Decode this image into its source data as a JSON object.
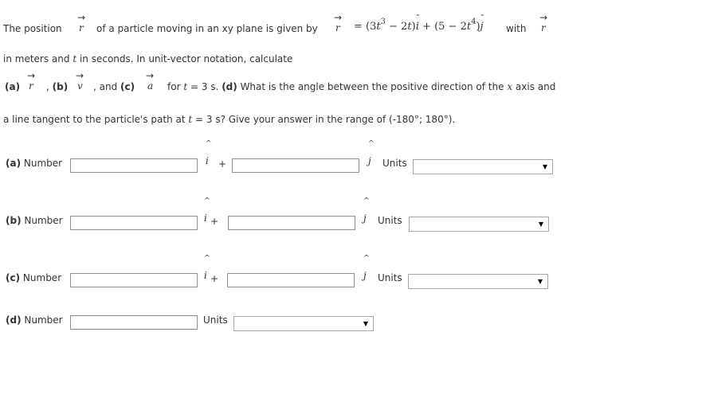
{
  "question": {
    "text_the_position": "The position",
    "text_of_particle": "of a particle moving in an xy plane is given by",
    "vec_r": "r",
    "vec_v": "v",
    "vec_a": "a",
    "formula": {
      "equals": "= (3",
      "t": "t",
      "exp3": "3",
      "minus_2t": " − 2",
      "close_i": ")",
      "i": "i",
      "plus_5": " + (5 − 2",
      "exp4": "4",
      "close_j": ")",
      "j": "j"
    },
    "text_with": "with",
    "line2_a": "in meters and ",
    "line2_t": "t",
    "line2_b": " in seconds. In unit-vector notation, calculate",
    "line3_a": "(a)",
    "line3_comma": ",",
    "line3_b": "(b)",
    "line3_and": ", and",
    "line3_c": "(c)",
    "line3_for": "for ",
    "line3_t": "t",
    "line3_eq": " = 3 s.",
    "line3_d": "(d)",
    "line3_rest": " What is the angle between the positive direction of the ",
    "line3_x": "x",
    "line3_axis": " axis and",
    "line4_a": "a line tangent to the particle's path at ",
    "line4_t": "t",
    "line4_rest": " = 3 s? Give your answer in the range of (-180°; 180°)."
  },
  "answers": [
    {
      "label": "(a)",
      "number": "Number",
      "i": "i",
      "plus": "+",
      "j": "j",
      "units": "Units",
      "unit_value": ""
    },
    {
      "label": "(b)",
      "number": "Number",
      "i": "i",
      "plus": "+",
      "j": "j",
      "units": "Units",
      "unit_value": ""
    },
    {
      "label": "(c)",
      "number": "Number",
      "i": "i",
      "plus": "+",
      "j": "j",
      "units": "Units",
      "unit_value": ""
    },
    {
      "label": "(d)",
      "number": "Number",
      "units": "Units",
      "unit_value": ""
    }
  ],
  "icons": {
    "dropdown": "caret-down-icon"
  }
}
